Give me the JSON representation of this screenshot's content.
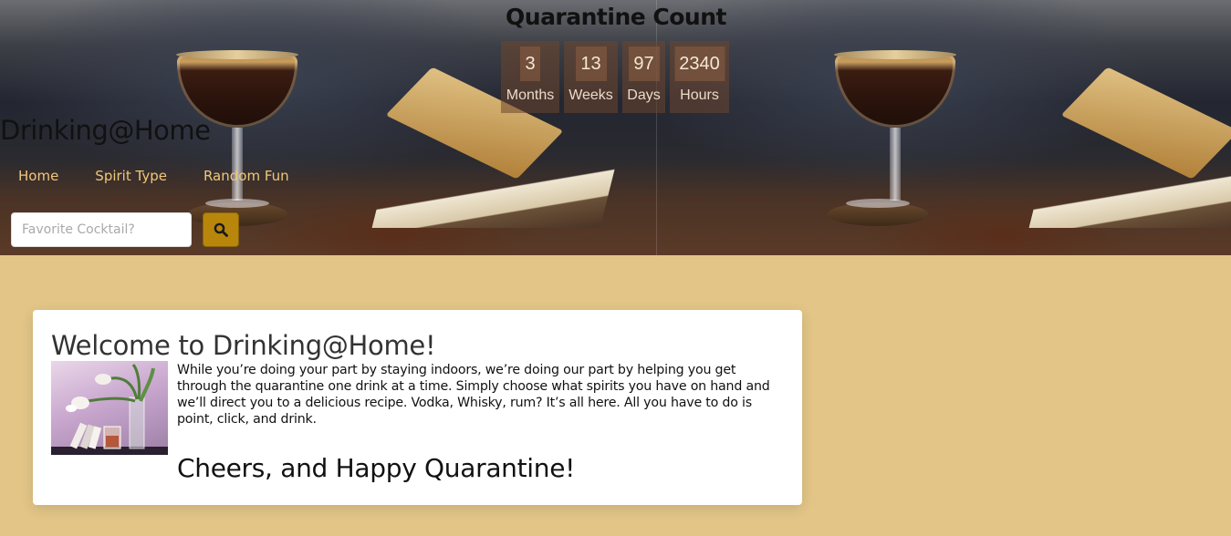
{
  "header": {
    "site_title": "Drinking@Home",
    "nav": [
      {
        "label": "Home"
      },
      {
        "label": "Spirit Type"
      },
      {
        "label": "Random Fun"
      }
    ],
    "search": {
      "placeholder": "Favorite Cocktail?",
      "value": "",
      "button_icon": "search-icon"
    }
  },
  "quarantine_count": {
    "title": "Quarantine Count",
    "counters": [
      {
        "value": "3",
        "unit": "Months"
      },
      {
        "value": "13",
        "unit": "Weeks"
      },
      {
        "value": "97",
        "unit": "Days"
      },
      {
        "value": "2340",
        "unit": "Hours"
      }
    ]
  },
  "welcome": {
    "title": "Welcome to Drinking@Home!",
    "body": "While you’re doing your part by staying indoors, we’re doing our part by helping you get through the quarantine one drink at a time. Simply choose what spirits you have on hand and we’ll direct you to a delicious recipe. Vodka, Whisky, rum? It’s all here. All you have to do is point, click, and drink.",
    "closing": "Cheers, and Happy Quarantine!"
  },
  "colors": {
    "page_background": "#e2c587",
    "nav_link": "#f0c77a",
    "search_button": "#b8860b",
    "counter_background": "#6e462d",
    "card_background": "#ffffff"
  }
}
